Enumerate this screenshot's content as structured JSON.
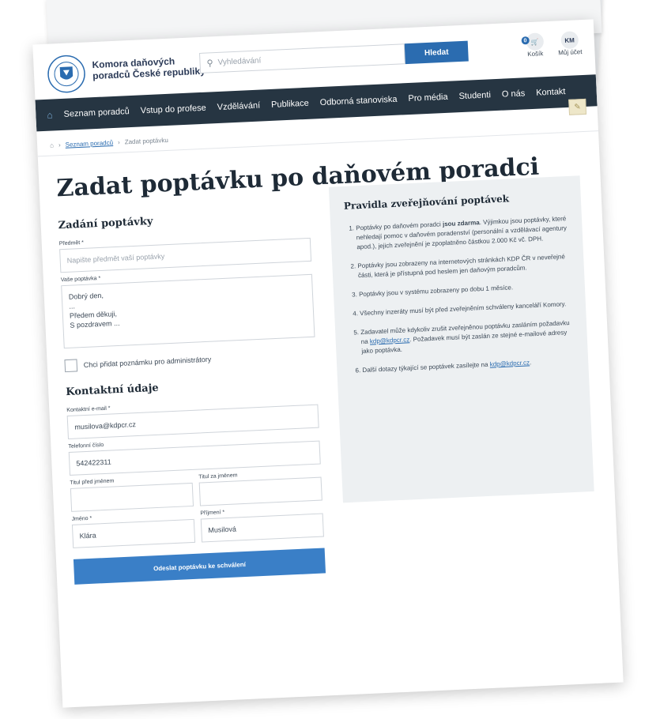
{
  "header": {
    "org_line1": "Komora daňových",
    "org_line2": "poradců České republiky",
    "search_placeholder": "Vyhledávání",
    "search_button": "Hledat",
    "cart_label": "Košík",
    "cart_count": "0",
    "account_initials": "KM",
    "account_label": "Můj účet"
  },
  "nav": {
    "items": [
      "Seznam poradců",
      "Vstup do profese",
      "Vzdělávání",
      "Publikace",
      "Odborná stanoviska",
      "Pro média",
      "Studenti",
      "O nás",
      "Kontakt"
    ]
  },
  "breadcrumb": {
    "link": "Seznam poradců",
    "current": "Zadat poptávku"
  },
  "page_title": "Zadat poptávku po daňovém poradci",
  "form": {
    "section_title": "Zadání poptávky",
    "subject_label": "Předmět *",
    "subject_placeholder": "Napište předmět vaší poptávky",
    "request_label": "Vaše poptávka *",
    "request_line1": "Dobrý den,",
    "request_line2": "...",
    "request_line3": "Předem děkuji,",
    "request_line4": "S pozdravem ...",
    "admin_note_label": "Chci přidat poznámku pro administrátory",
    "contact_title": "Kontaktní údaje",
    "email_label": "Kontaktní e-mail *",
    "email_value": "musilova@kdpcr.cz",
    "phone_label": "Telefonní číslo",
    "phone_value": "542422311",
    "title_before_label": "Titul před jménem",
    "title_before_value": "",
    "title_after_label": "Titul za jménem",
    "title_after_value": "",
    "first_name_label": "Jméno *",
    "first_name_value": "Klára",
    "last_name_label": "Příjmení *",
    "last_name_value": "Musilová",
    "submit_label": "Odeslat poptávku ke schválení"
  },
  "rules": {
    "title": "Pravidla zveřejňování poptávek",
    "r1_pre": "Poptávky po daňovém poradci",
    "r1_bold": "jsou zdarma",
    "r1_post": ". Výjimkou jsou poptávky, které nehledají pomoc v daňovém poradenství (personální a vzdělávací agentury apod.), jejich zveřejnění je zpoplatněno částkou 2.000 Kč vč. DPH.",
    "r2": "Poptávky jsou zobrazeny na internetových stránkách KDP ČR v neveřejné části, která je přístupná pod heslem jen daňovým poradcům.",
    "r3": "Poptávky jsou v systému zobrazeny po dobu 1 měsíce.",
    "r4": "Všechny inzeráty musí být před zveřejněním schváleny kanceláří Komory.",
    "r5_pre": "Zadavatel může kdykoliv zrušit zveřejněnou poptávku zasláním požadavku na",
    "r5_link": "kdp@kdpcr.cz",
    "r5_post": ". Požadavek musí být zaslán ze stejné e-mailové adresy jako poptávka.",
    "r6_pre": "Další dotazy týkající se poptávek zasílejte na",
    "r6_link": "kdp@kdpcr.cz"
  },
  "colors": {
    "nav_bg": "#263542",
    "accent": "#2b6cb0",
    "panel_bg": "#edf0f2"
  }
}
